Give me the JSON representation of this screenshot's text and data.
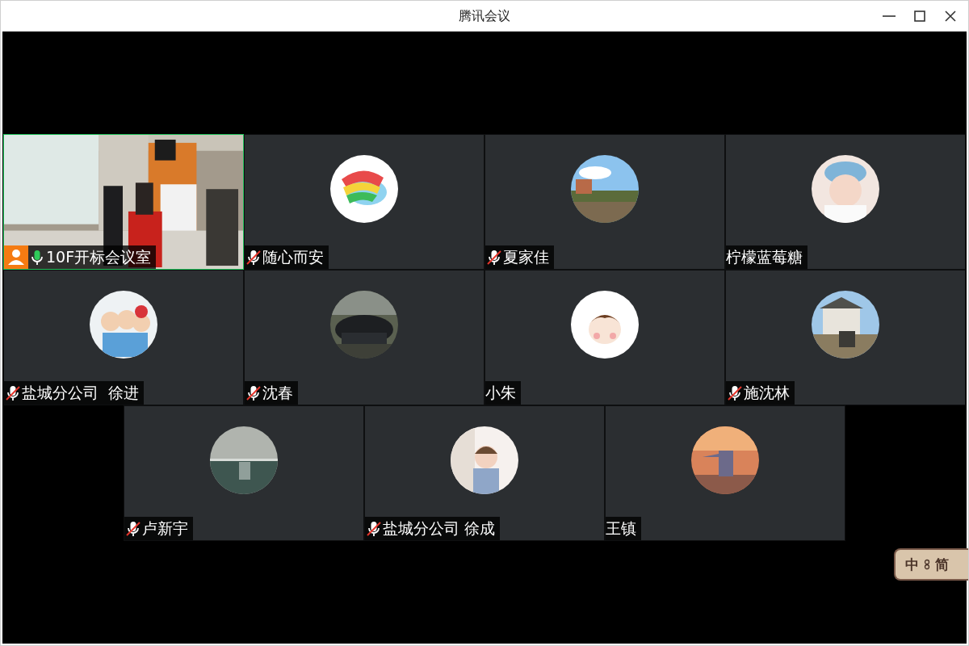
{
  "window": {
    "title": "腾讯会议"
  },
  "rows": [
    [
      {
        "kind": "video",
        "name": "10F开标会议室",
        "audio": true,
        "muted": false,
        "host": true,
        "speaking": true
      },
      {
        "kind": "avatar",
        "name": "随心而安",
        "audio": true,
        "muted": true,
        "host": false,
        "speaking": false
      },
      {
        "kind": "avatar",
        "name": "夏家佳",
        "audio": true,
        "muted": true,
        "host": false,
        "speaking": false
      },
      {
        "kind": "avatar",
        "name": "柠檬蓝莓糖",
        "audio": false,
        "host": false,
        "speaking": false
      }
    ],
    [
      {
        "kind": "avatar",
        "name": "盐城分公司  徐进",
        "audio": true,
        "muted": true,
        "host": false,
        "speaking": false
      },
      {
        "kind": "avatar",
        "name": "沈春",
        "audio": true,
        "muted": true,
        "host": false,
        "speaking": false
      },
      {
        "kind": "avatar",
        "name": "小朱",
        "audio": false,
        "host": false,
        "speaking": false
      },
      {
        "kind": "avatar",
        "name": "施沈林",
        "audio": true,
        "muted": true,
        "host": false,
        "speaking": false
      }
    ],
    [
      {
        "kind": "avatar",
        "name": "卢新宇",
        "audio": true,
        "muted": true,
        "host": false,
        "speaking": false
      },
      {
        "kind": "avatar",
        "name": "盐城分公司 徐成",
        "audio": true,
        "muted": true,
        "host": false,
        "speaking": false
      },
      {
        "kind": "avatar",
        "name": "王镇",
        "audio": false,
        "host": false,
        "speaking": false
      }
    ]
  ],
  "ime": {
    "labels": [
      "中",
      "简"
    ]
  }
}
